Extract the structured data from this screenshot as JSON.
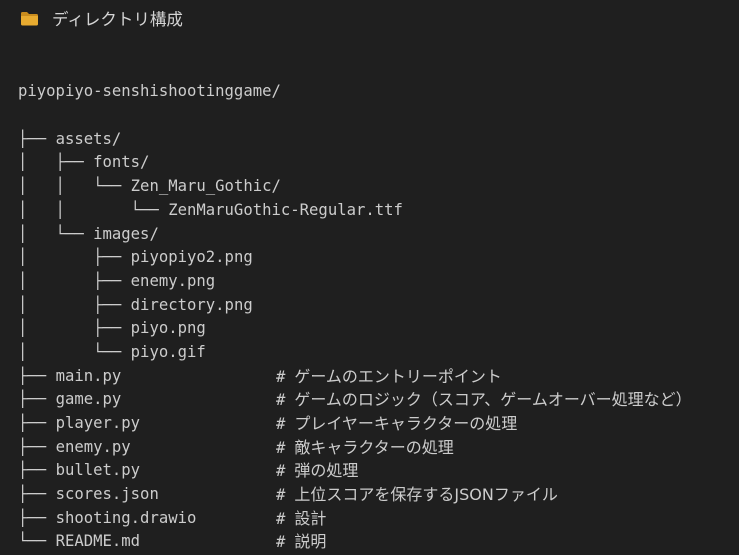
{
  "heading": {
    "title": "ディレクトリ構成",
    "icon": "folder-icon",
    "icon_color": "#e8ab30"
  },
  "tree": {
    "root": "piyopiyo-senshishootinggame/",
    "comment_marker": "#",
    "lines": [
      {
        "prefix": "├── ",
        "name": "assets/",
        "comment": ""
      },
      {
        "prefix": "│   ├── ",
        "name": "fonts/",
        "comment": ""
      },
      {
        "prefix": "│   │   └── ",
        "name": "Zen_Maru_Gothic/",
        "comment": ""
      },
      {
        "prefix": "│   │       └── ",
        "name": "ZenMaruGothic-Regular.ttf",
        "comment": ""
      },
      {
        "prefix": "│   └── ",
        "name": "images/",
        "comment": ""
      },
      {
        "prefix": "│       ├── ",
        "name": "piyopiyo2.png",
        "comment": ""
      },
      {
        "prefix": "│       ├── ",
        "name": "enemy.png",
        "comment": ""
      },
      {
        "prefix": "│       ├── ",
        "name": "directory.png",
        "comment": ""
      },
      {
        "prefix": "│       ├── ",
        "name": "piyo.png",
        "comment": ""
      },
      {
        "prefix": "│       └── ",
        "name": "piyo.gif",
        "comment": ""
      },
      {
        "prefix": "├── ",
        "name": "main.py",
        "comment": "ゲームのエントリーポイント"
      },
      {
        "prefix": "├── ",
        "name": "game.py",
        "comment": "ゲームのロジック（スコア、ゲームオーバー処理など）"
      },
      {
        "prefix": "├── ",
        "name": "player.py",
        "comment": "プレイヤーキャラクターの処理"
      },
      {
        "prefix": "├── ",
        "name": "enemy.py",
        "comment": "敵キャラクターの処理"
      },
      {
        "prefix": "├── ",
        "name": "bullet.py",
        "comment": "弾の処理"
      },
      {
        "prefix": "├── ",
        "name": "scores.json",
        "comment": "上位スコアを保存するJSONファイル"
      },
      {
        "prefix": "├── ",
        "name": "shooting.drawio",
        "comment": "設計"
      },
      {
        "prefix": "└── ",
        "name": "README.md",
        "comment": "説明"
      }
    ]
  }
}
